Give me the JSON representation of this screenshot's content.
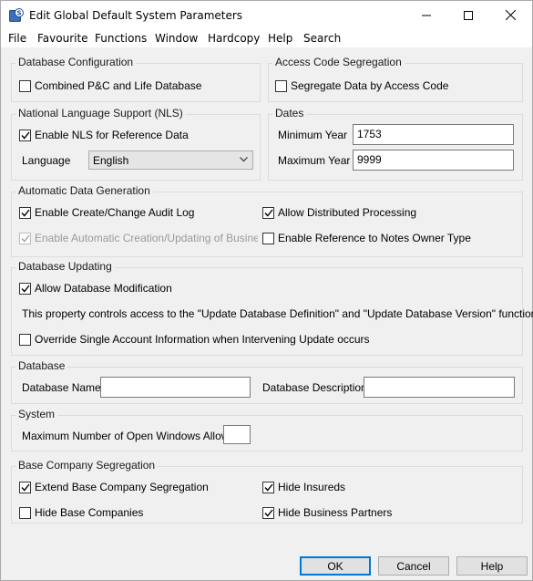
{
  "window": {
    "title": "Edit Global Default System Parameters",
    "icon": "app-s-icon",
    "accent": "#0078d7"
  },
  "menu": [
    "File",
    "Favourite",
    "Functions",
    "Window",
    "Hardcopy",
    "Help",
    "Search"
  ],
  "db_config": {
    "label": "Database Configuration",
    "combined": {
      "label": "Combined P&C and Life Database",
      "checked": false
    }
  },
  "access_code": {
    "label": "Access Code Segregation",
    "segregate": {
      "label": "Segregate Data by Access Code",
      "checked": false
    }
  },
  "nls": {
    "label": "National Language Support (NLS)",
    "enable": {
      "label": "Enable NLS for Reference Data",
      "checked": true
    },
    "language_label": "Language",
    "language_value": "English"
  },
  "dates": {
    "label": "Dates",
    "min_label": "Minimum Year",
    "min_value": "1753",
    "max_label": "Maximum Year",
    "max_value": "9999"
  },
  "auto_gen": {
    "label": "Automatic Data Generation",
    "audit_log": {
      "label": "Enable Create/Change Audit Log",
      "checked": true
    },
    "distributed": {
      "label": "Allow Distributed Processing",
      "checked": true
    },
    "auto_bp": {
      "label": "Enable Automatic Creation/Updating of Business Str",
      "checked": true,
      "disabled": true
    },
    "notes_owner": {
      "label": "Enable Reference to Notes Owner Type",
      "checked": false
    }
  },
  "db_updating": {
    "label": "Database Updating",
    "allow_mod": {
      "label": "Allow Database Modification",
      "checked": true
    },
    "note": "This property controls access to the \"Update Database Definition\" and \"Update Database Version\" functions.",
    "override": {
      "label": "Override Single Account Information when Intervening Update occurs",
      "checked": false
    }
  },
  "database": {
    "label": "Database",
    "name_label": "Database Name",
    "name_value": "",
    "desc_label": "Database Description",
    "desc_value": ""
  },
  "system": {
    "label": "System",
    "max_windows_label": "Maximum Number of Open Windows Allowed",
    "max_windows_value": ""
  },
  "base_company": {
    "label": "Base Company Segregation",
    "extend": {
      "label": "Extend Base Company Segregation",
      "checked": true
    },
    "hide_insureds": {
      "label": "Hide Insureds",
      "checked": true
    },
    "hide_base": {
      "label": "Hide Base Companies",
      "checked": false
    },
    "hide_bp": {
      "label": "Hide Business Partners",
      "checked": true
    }
  },
  "buttons": {
    "ok": "OK",
    "cancel": "Cancel",
    "help": "Help"
  }
}
